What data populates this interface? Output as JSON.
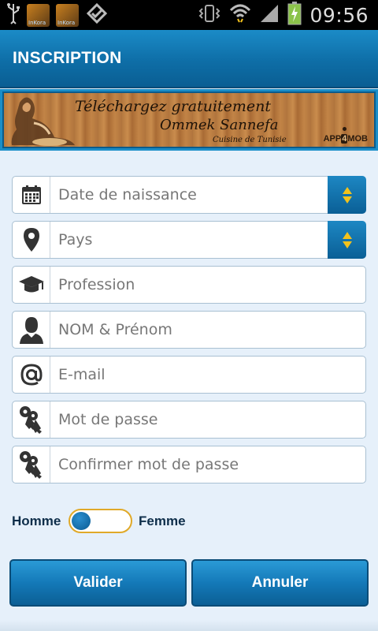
{
  "status_bar": {
    "time": "09:56",
    "left_icons": [
      "usb-icon",
      "app-notification-icon",
      "app-notification-icon",
      "checkmark-icon"
    ],
    "app_icon_label": "InKora",
    "right_icons": [
      "vibrate-icon",
      "wifi-icon",
      "signal-icon",
      "battery-charging-icon"
    ]
  },
  "title_bar": {
    "title": "INSCRIPTION"
  },
  "banner": {
    "line1": "Téléchargez gratuitement",
    "line2": "Ommek Sannefa",
    "line3": "Cuisine de Tunisie",
    "logo_pre": "APP",
    "logo_num": "4",
    "logo_post": "MOB"
  },
  "form": {
    "fields": [
      {
        "name": "birthdate",
        "placeholder": "Date de naissance",
        "icon": "calendar-icon",
        "has_spinner": true
      },
      {
        "name": "country",
        "placeholder": "Pays",
        "icon": "location-pin-icon",
        "has_spinner": true
      },
      {
        "name": "profession",
        "placeholder": "Profession",
        "icon": "graduation-cap-icon",
        "has_spinner": false
      },
      {
        "name": "name",
        "placeholder": "NOM & Prénom",
        "icon": "user-icon",
        "has_spinner": false
      },
      {
        "name": "email",
        "placeholder": "E-mail",
        "icon": "at-sign-icon",
        "has_spinner": false
      },
      {
        "name": "password",
        "placeholder": "Mot de passe",
        "icon": "keys-icon",
        "has_spinner": false
      },
      {
        "name": "confirm_password",
        "placeholder": "Confirmer mot de passe",
        "icon": "keys-icon",
        "has_spinner": false
      }
    ]
  },
  "gender": {
    "left_label": "Homme",
    "right_label": "Femme",
    "selected": "Homme"
  },
  "buttons": {
    "submit": "Valider",
    "cancel": "Annuler"
  },
  "colors": {
    "primary": "#0e6ea7",
    "accent": "#f3c21c",
    "background": "#e6f0fa",
    "toggle_border": "#e0a928"
  }
}
